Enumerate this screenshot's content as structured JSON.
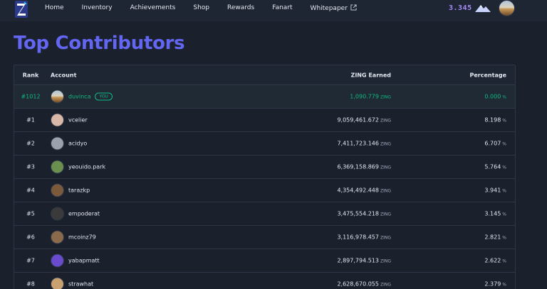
{
  "nav": {
    "links": [
      "Home",
      "Inventory",
      "Achievements",
      "Shop",
      "Rewards",
      "Fanart",
      "Whitepaper"
    ],
    "points": "3.345"
  },
  "page_title": "Top Contributors",
  "table": {
    "headers": {
      "rank": "Rank",
      "account": "Account",
      "zing": "ZING Earned",
      "pct": "Percentage"
    },
    "unit_zing": "ZING",
    "unit_pct": "%",
    "you_label": "YOU",
    "current_user": {
      "rank": "#1012",
      "name": "duvinca",
      "zing": "1,090.779",
      "pct": "0.000"
    },
    "rows": [
      {
        "rank": "#1",
        "name": "vcelier",
        "zing": "9,059,461.672",
        "pct": "8.198",
        "avatar_color": "#d9b8a8"
      },
      {
        "rank": "#2",
        "name": "acidyo",
        "zing": "7,411,723.146",
        "pct": "6.707",
        "avatar_color": "#9aa3ad"
      },
      {
        "rank": "#3",
        "name": "yeouido.park",
        "zing": "6,369,158.869",
        "pct": "5.764",
        "avatar_color": "#6b8f4e"
      },
      {
        "rank": "#4",
        "name": "tarazkp",
        "zing": "4,354,492.448",
        "pct": "3.941",
        "avatar_color": "#7a5a3a"
      },
      {
        "rank": "#5",
        "name": "empoderat",
        "zing": "3,475,554.218",
        "pct": "3.145",
        "avatar_color": "#3a3a3a"
      },
      {
        "rank": "#6",
        "name": "mcoinz79",
        "zing": "3,116,978.457",
        "pct": "2.821",
        "avatar_color": "#8a6a4a"
      },
      {
        "rank": "#7",
        "name": "yabapmatt",
        "zing": "2,897,794.513",
        "pct": "2.622",
        "avatar_color": "#6a4acd"
      },
      {
        "rank": "#8",
        "name": "strawhat",
        "zing": "2,628,670.055",
        "pct": "2.379",
        "avatar_color": "#c9a070"
      }
    ]
  }
}
